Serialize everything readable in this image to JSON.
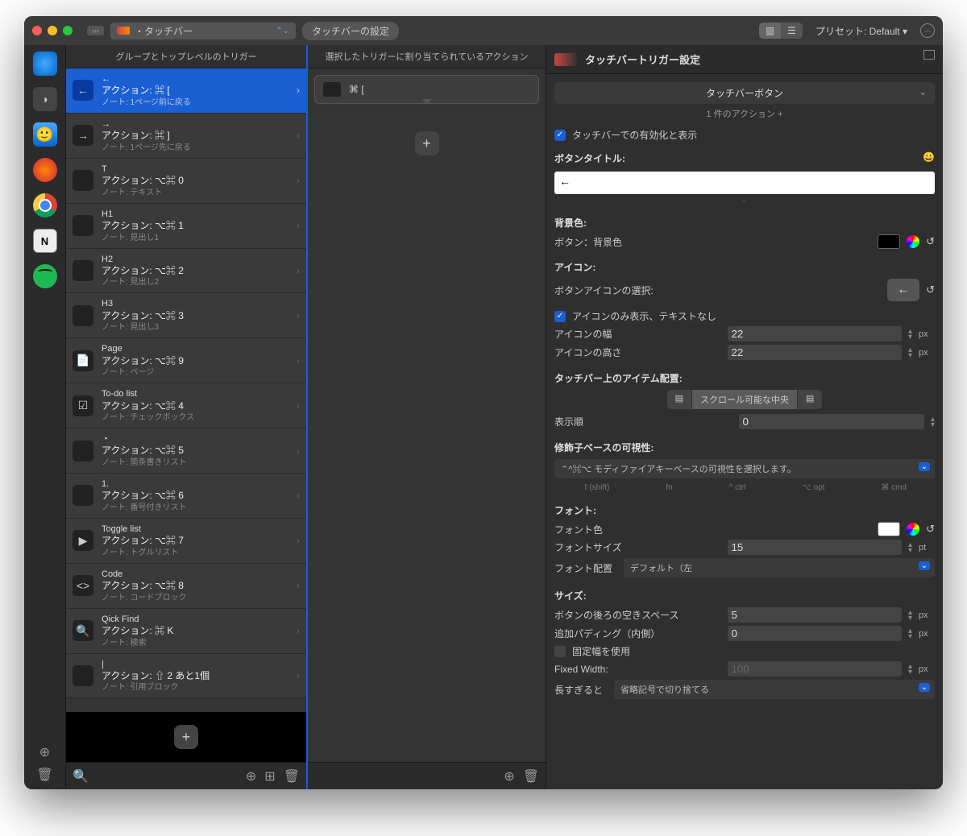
{
  "titlebar": {
    "dropdown_label": "・タッチバー",
    "settings_btn": "タッチバーの設定",
    "preset": "プリセット: Default ▾"
  },
  "columns": {
    "col1_header": "グループとトップレベルのトリガー",
    "col2_header": "選択したトリガーに割り当てられているアクション",
    "col3_header": "タッチバートリガー設定"
  },
  "triggers": [
    {
      "top": "←",
      "title": "アクション: ⌘ [",
      "note": "ノート: 1ページ前に戻る",
      "icon": "←",
      "selected": true
    },
    {
      "top": "→",
      "title": "アクション: ⌘ ]",
      "note": "ノート: 1ページ先に戻る",
      "icon": "→"
    },
    {
      "top": "T",
      "title": "アクション: ⌥⌘ 0",
      "note": "ノート: テキスト",
      "icon": ""
    },
    {
      "top": "H1",
      "title": "アクション: ⌥⌘ 1",
      "note": "ノート: 見出し1",
      "icon": ""
    },
    {
      "top": "H2",
      "title": "アクション: ⌥⌘ 2",
      "note": "ノート: 見出し2",
      "icon": ""
    },
    {
      "top": "H3",
      "title": "アクション: ⌥⌘ 3",
      "note": "ノート: 見出し3",
      "icon": ""
    },
    {
      "top": "Page",
      "title": "アクション: ⌥⌘ 9",
      "note": "ノート: ページ",
      "icon": "📄"
    },
    {
      "top": "To-do list",
      "title": "アクション: ⌥⌘ 4",
      "note": "ノート: チェックボックス",
      "icon": "☑"
    },
    {
      "top": "・",
      "title": "アクション: ⌥⌘ 5",
      "note": "ノート: 箇条書きリスト",
      "icon": ""
    },
    {
      "top": "1.",
      "title": "アクション: ⌥⌘ 6",
      "note": "ノート: 番号付きリスト",
      "icon": ""
    },
    {
      "top": "Toggle list",
      "title": "アクション: ⌥⌘ 7",
      "note": "ノート: トグルリスト",
      "icon": "▶"
    },
    {
      "top": "Code",
      "title": "アクション: ⌥⌘ 8",
      "note": "ノート: コードブロック",
      "icon": "<>"
    },
    {
      "top": "Qick Find",
      "title": "アクション: ⌘ K",
      "note": "ノート: 検索",
      "icon": "🔍"
    },
    {
      "top": "|",
      "title": "アクション: ⇧ 2 あと1個",
      "note": "ノート: 引用ブロック",
      "icon": ""
    }
  ],
  "action": {
    "label": "⌘ ["
  },
  "inspector": {
    "section_btn": "タッチバーボタン",
    "action_count": "1 件のアクション +",
    "enable_label": "タッチバーでの有効化と表示",
    "button_title_label": "ボタンタイトル:",
    "button_title_value": "←",
    "bg_section": "背景色:",
    "bg_label": "ボタン：背景色",
    "icon_section": "アイコン:",
    "icon_label": "ボタンアイコンの選択:",
    "icon_only_label": "アイコンのみ表示、テキストなし",
    "icon_width_label": "アイコンの幅",
    "icon_width_value": "22",
    "icon_height_label": "アイコンの高さ",
    "icon_height_value": "22",
    "placement_section": "タッチバー上のアイテム配置:",
    "placement_center": "スクロール可能な中央",
    "order_label": "表示順",
    "order_value": "0",
    "modifier_section": "修飾子ベースの可視性:",
    "modifier_select": "⌃^⌘⌥ モディファイアキーベースの可視性を選択します。",
    "mods": [
      "⇧(shift)",
      "fn",
      "^ ctrl",
      "⌥ opt",
      "⌘ cmd"
    ],
    "font_section": "フォント:",
    "font_color_label": "フォント色",
    "font_size_label": "フォントサイズ",
    "font_size_value": "15",
    "font_align_label": "フォント配置",
    "font_align_value": "デフォルト（左",
    "size_section": "サイズ:",
    "space_after_label": "ボタンの後ろの空きスペース",
    "space_after_value": "5",
    "padding_label": "追加パディング（内側）",
    "padding_value": "0",
    "fixed_width_check": "固定幅を使用",
    "fixed_width_label": "Fixed Width:",
    "fixed_width_value": "100",
    "too_long_label": "長すぎると",
    "too_long_value": "省略記号で切り捨てる",
    "px": "px",
    "pt": "pt"
  }
}
